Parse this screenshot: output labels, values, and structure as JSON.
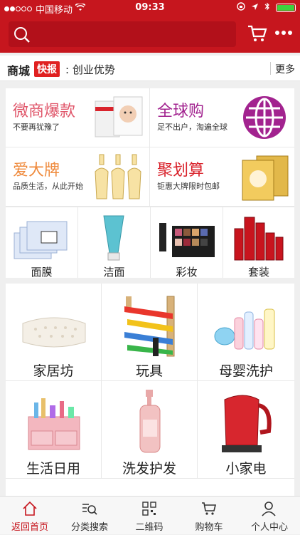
{
  "status_bar": {
    "carrier": "中国移动",
    "time": "09:33"
  },
  "news": {
    "brand": "商城",
    "badge": "快报",
    "headline": ": 创业优势",
    "more": "更多"
  },
  "promo": [
    {
      "title": "微商爆款",
      "subtitle": "不要再犹豫了",
      "color": "#e0566a"
    },
    {
      "title": "全球购",
      "subtitle": "足不出户，淘遍全球",
      "color": "#a2238f"
    },
    {
      "title": "爱大牌",
      "subtitle": "品质生活，从此开始",
      "color": "#ef8a3c"
    },
    {
      "title": "聚划算",
      "subtitle": "钜惠大牌限时包邮",
      "color": "#d9232c"
    }
  ],
  "categories": [
    "面膜",
    "洁面",
    "彩妆",
    "套装"
  ],
  "grid": [
    "家居坊",
    "玩具",
    "母婴洗护",
    "生活日用",
    "洗发护发",
    "小家电"
  ],
  "tabs": [
    "返回首页",
    "分类搜索",
    "二维码",
    "购物车",
    "个人中心"
  ],
  "colors": {
    "accent": "#c6161e"
  }
}
